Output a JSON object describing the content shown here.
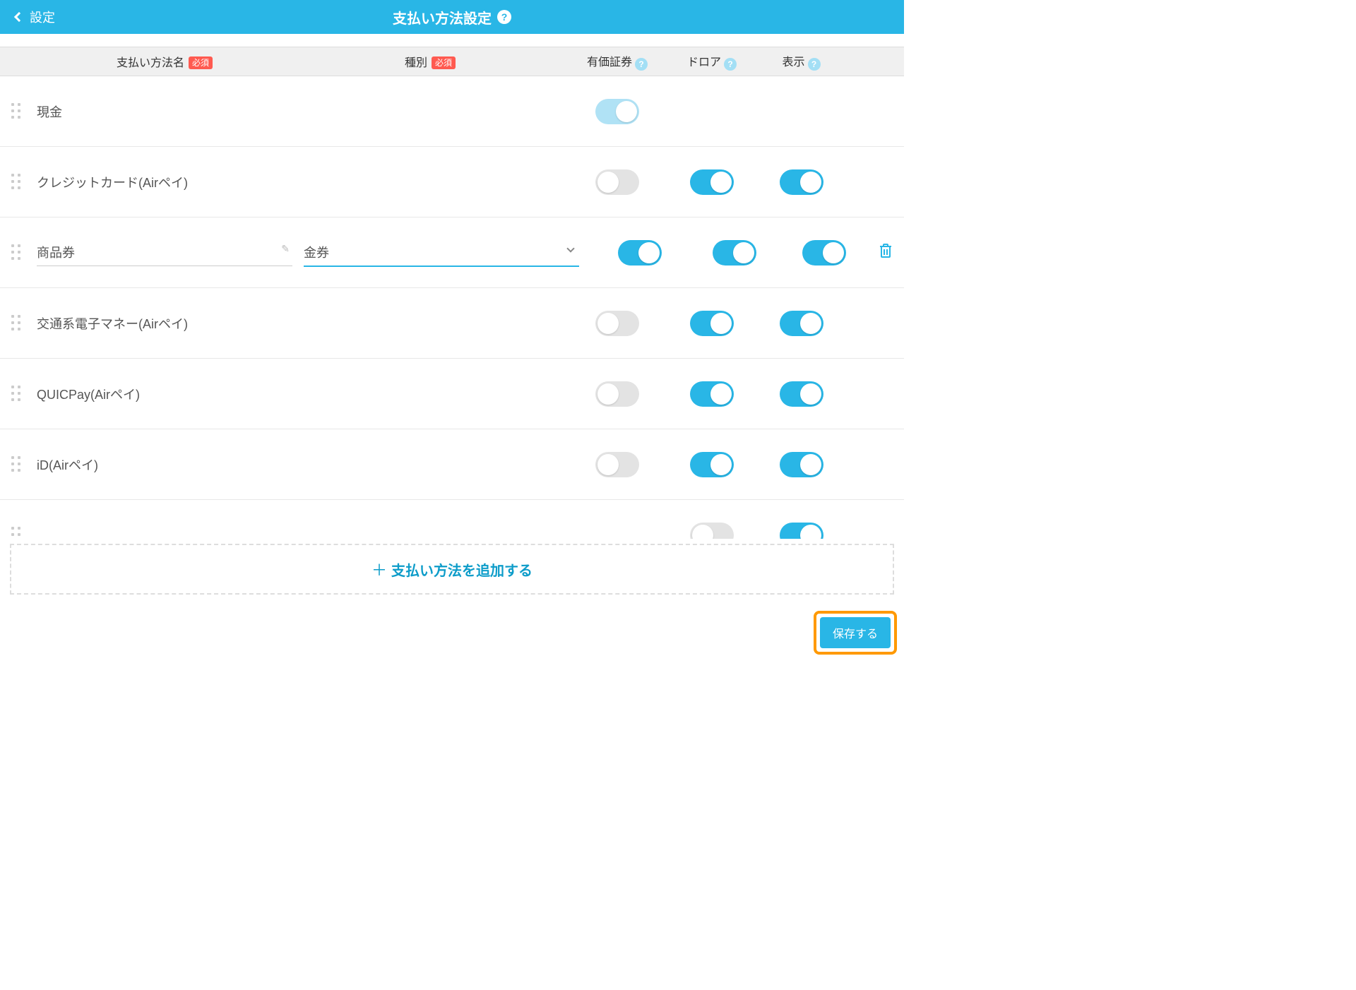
{
  "header": {
    "back_label": "設定",
    "title": "支払い方法設定"
  },
  "columns": {
    "name": "支払い方法名",
    "type": "種別",
    "securities": "有価証券",
    "drawer": "ドロア",
    "display": "表示",
    "required_badge": "必須"
  },
  "rows": [
    {
      "name": "現金",
      "type": "",
      "editable": false,
      "securities": "on-disabled",
      "drawer": null,
      "display": null,
      "deletable": false
    },
    {
      "name": "クレジットカード(Airペイ)",
      "type": "",
      "editable": false,
      "securities": "off",
      "drawer": "on",
      "display": "on",
      "deletable": false
    },
    {
      "name": "商品券",
      "type": "金券",
      "editable": true,
      "securities": "on",
      "drawer": "on",
      "display": "on",
      "deletable": true
    },
    {
      "name": "交通系電子マネー(Airペイ)",
      "type": "",
      "editable": false,
      "securities": "off",
      "drawer": "on",
      "display": "on",
      "deletable": false
    },
    {
      "name": "QUICPay(Airペイ)",
      "type": "",
      "editable": false,
      "securities": "off",
      "drawer": "on",
      "display": "on",
      "deletable": false
    },
    {
      "name": "iD(Airペイ)",
      "type": "",
      "editable": false,
      "securities": "off",
      "drawer": "on",
      "display": "on",
      "deletable": false
    },
    {
      "name": "",
      "type": "",
      "editable": false,
      "securities": null,
      "drawer": "off",
      "display": "on",
      "deletable": false
    }
  ],
  "add_label": "支払い方法を追加する",
  "save_label": "保存する"
}
